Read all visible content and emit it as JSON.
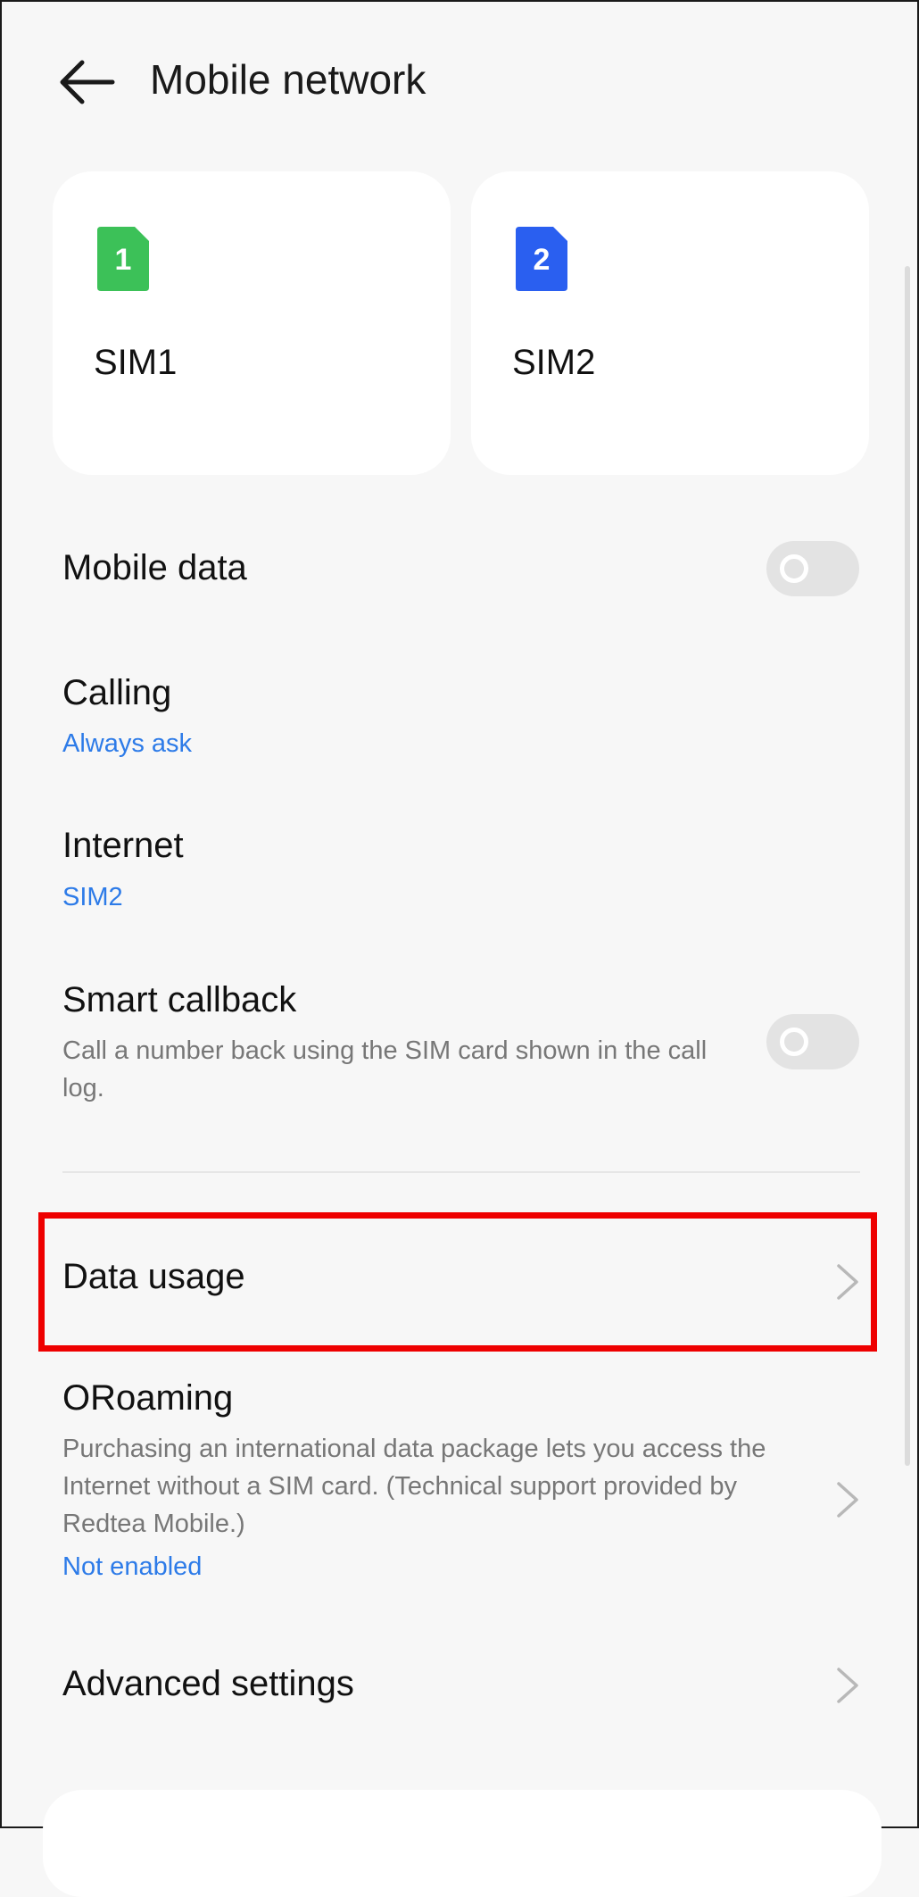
{
  "header": {
    "title": "Mobile network"
  },
  "sim_cards": [
    {
      "badge": "1",
      "label": "SIM1",
      "color": "#3cc158"
    },
    {
      "badge": "2",
      "label": "SIM2",
      "color": "#2a5ff0"
    }
  ],
  "settings": {
    "mobile_data": {
      "title": "Mobile data",
      "enabled": false
    },
    "calling": {
      "title": "Calling",
      "value": "Always ask"
    },
    "internet": {
      "title": "Internet",
      "value": "SIM2"
    },
    "smart_callback": {
      "title": "Smart callback",
      "description": "Call a number back using the SIM card shown in the call log.",
      "enabled": false
    },
    "data_usage": {
      "title": "Data usage"
    },
    "oroaming": {
      "title": "ORoaming",
      "description": "Purchasing an international data package lets you access the Internet without a SIM card. (Technical support provided by Redtea Mobile.)",
      "status": "Not enabled"
    },
    "advanced": {
      "title": "Advanced settings"
    }
  },
  "colors": {
    "accent": "#2d7be8",
    "highlight": "#ee0000"
  }
}
